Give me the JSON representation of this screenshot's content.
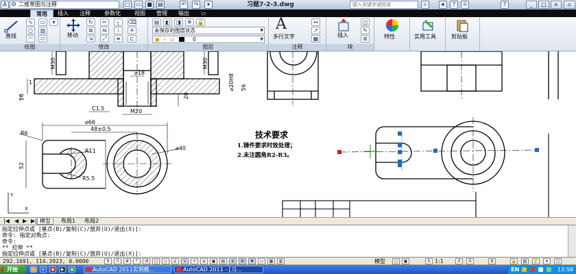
{
  "titlebar": {
    "workspace": "二维草图与注释",
    "title": "习题7-2-3.dwg",
    "search_placeholder": "键入关键字或短语"
  },
  "ribbon_tabs": [
    "常用",
    "插入",
    "注释",
    "参数化",
    "视图",
    "管理",
    "输出"
  ],
  "ribbon": {
    "draw": {
      "line_label": "直线",
      "panel_label": "绘图"
    },
    "modify": {
      "move_label": "移动",
      "panel_label": "修改"
    },
    "layers": {
      "state_combo": "未保存的图层状态",
      "layer_combo": "0",
      "panel_label": "图层"
    },
    "annotation": {
      "mtext_label": "多行文字",
      "panel_label": "注释"
    },
    "block": {
      "insert_label": "插入",
      "panel_label": "块"
    },
    "properties_label": "特性",
    "utilities_label": "实用工具",
    "clipboard_label": "剪贴板"
  },
  "drawing": {
    "dims": {
      "m30_left": "M30",
      "phi18": "⌀18",
      "m30_right": "M30",
      "phi20_h8": "⌀20H8",
      "phi56": "56",
      "dim20": "20",
      "dim16": "16",
      "dim1": "1",
      "c15": "C1.5",
      "m20": "M20",
      "phi66": "⌀66",
      "dim48": "48±0.5",
      "r6": "R6",
      "r11": "R11",
      "phi40": "⌀40",
      "dim52": "52",
      "r55": "R5.5"
    },
    "notes": {
      "heading": "技术要求",
      "line1": "1.铸件要求时效处理；",
      "line2": "2.未注圆角R2-R3。"
    }
  },
  "layout_tabs": [
    "模型",
    "布局1",
    "布局2"
  ],
  "command_lines": [
    "指定拉伸点或 [基点(B)/复制(C)/放弃(U)/退出(X)]:",
    "命令: 指定对角点:",
    "命令:",
    "** 拉伸 **",
    "指定拉伸点或 [基点(B)/复制(C)/放弃(U)/退出(X)]:"
  ],
  "status": {
    "coords": "292.1691, 114.3923, 0.0000",
    "model": "模型",
    "scale": "1:1",
    "taskbar_start": "开始",
    "task1": "AutoCAD 2011实例教...",
    "task2": "AutoCAD 2011 - [习...",
    "tray_lang": "EN",
    "clock": "13:58"
  }
}
